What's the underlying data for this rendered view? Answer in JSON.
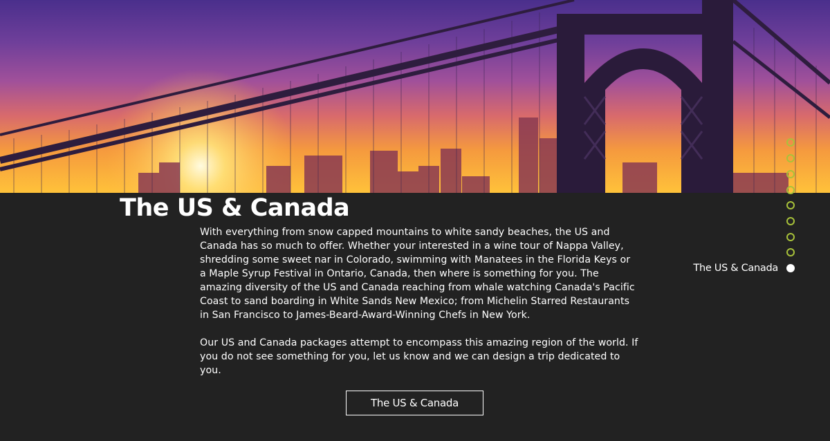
{
  "section": {
    "title": "The US & Canada",
    "paragraphs": [
      "With everything from snow capped mountains to white sandy beaches, the US and Canada has so much to offer. Whether your interested in a wine tour of Nappa Valley, shredding some sweet nar in Colorado, swimming with Manatees in the Florida Keys or a Maple Syrup Festival in Ontario, Canada, then where is something for you. The amazing diversity of the US and Canada reaching from whale watching Canada's Pacific Coast to sand boarding in White Sands New Mexico; from Michelin Starred Restaurants in San Francisco to James-Beard-Award-Winning Chefs in New York.",
      "Our US and Canada packages attempt to encompass this amazing region of the world. If you do not see something for you, let us know and we can design a trip dedicated to you."
    ],
    "button_label": "The US & Canada"
  },
  "hero": {
    "image_icon": "bridge-skyline-sunset-image"
  },
  "page_nav": {
    "active_label": "The US & Canada",
    "dot_count": 9,
    "active_index": 8,
    "accent_color": "#a8c23a",
    "active_color": "#ffffff"
  },
  "colors": {
    "background": "#222222",
    "text": "#ffffff"
  }
}
